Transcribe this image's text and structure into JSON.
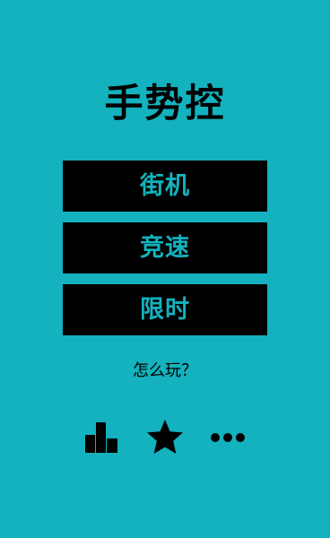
{
  "app": {
    "title": "手势控"
  },
  "menu": {
    "modes": [
      {
        "label": "街机"
      },
      {
        "label": "竞速"
      },
      {
        "label": "限时"
      }
    ],
    "how_to_play": "怎么玩？"
  },
  "bottom_bar": {
    "icons": [
      "leaderboard-icon",
      "star-icon",
      "more-icon"
    ]
  },
  "colors": {
    "background": "#13B2BE",
    "button_bg": "#000000",
    "button_text": "#13B2BE",
    "text": "#000000"
  }
}
